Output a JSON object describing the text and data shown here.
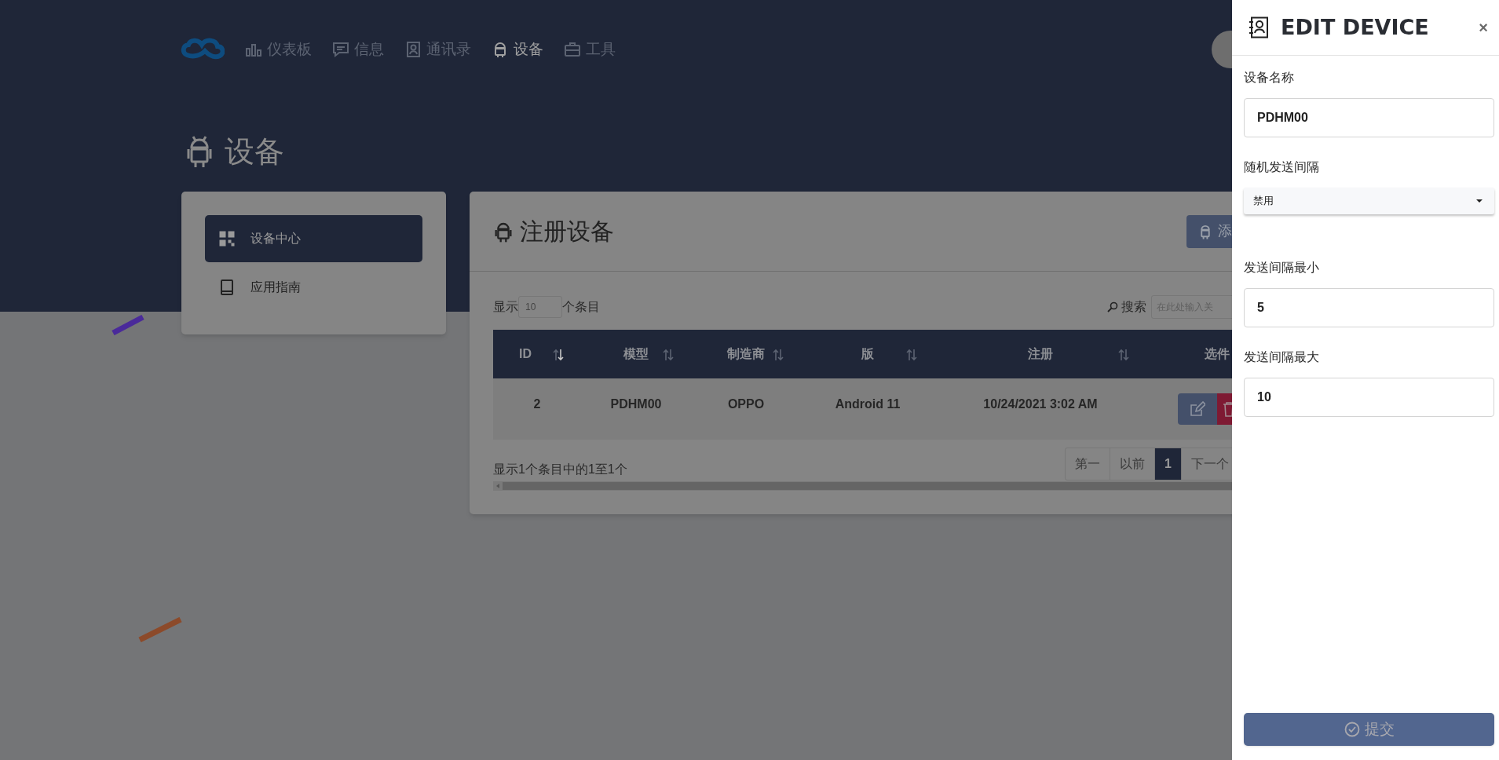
{
  "nav": {
    "items": [
      {
        "label": "仪表板",
        "selected": false
      },
      {
        "label": "信息",
        "selected": false
      },
      {
        "label": "通讯录",
        "selected": false
      },
      {
        "label": "设备",
        "selected": true
      },
      {
        "label": "工具",
        "selected": false
      }
    ]
  },
  "page_title": "设备",
  "sidebar": {
    "items": [
      {
        "label": "设备中心",
        "selected": true
      },
      {
        "label": "应用指南",
        "selected": false
      }
    ]
  },
  "card": {
    "title": "注册设备",
    "add_button": "添",
    "length_before": "显示",
    "length_value": "10",
    "length_after": "个条目",
    "search_label": "搜索",
    "search_placeholder": "在此处输入关"
  },
  "table": {
    "columns": [
      {
        "label": "ID",
        "sortable": true,
        "sorted": true
      },
      {
        "label": "模型",
        "sortable": true,
        "sorted": false
      },
      {
        "label": "制造商",
        "sortable": true,
        "sorted": false
      },
      {
        "label": "版",
        "sortable": true,
        "sorted": false
      },
      {
        "label": "注册",
        "sortable": true,
        "sorted": false
      },
      {
        "label": "选件",
        "sortable": false
      }
    ],
    "rows": [
      {
        "cells": [
          "2",
          "PDHM00",
          "OPPO",
          "Android 11",
          "10/24/2021 3:02 AM"
        ]
      }
    ]
  },
  "info": "显示1个条目中的1至1个",
  "pagination": [
    {
      "label": "第一",
      "selected": false
    },
    {
      "label": "以前",
      "selected": false
    },
    {
      "label": "1",
      "selected": true
    },
    {
      "label": "下一个",
      "selected": false
    }
  ],
  "panel": {
    "title": "EDIT DEVICE",
    "close": "×",
    "fields": [
      {
        "kind": "input",
        "label": "设备名称",
        "value": "PDHM00"
      },
      {
        "kind": "select",
        "label": "随机发送间隔",
        "value": "禁用"
      },
      {
        "kind": "input",
        "label": "发送间隔最小",
        "value": "5"
      },
      {
        "kind": "input",
        "label": "发送间隔最大",
        "value": "10"
      }
    ],
    "submit": "提交"
  }
}
